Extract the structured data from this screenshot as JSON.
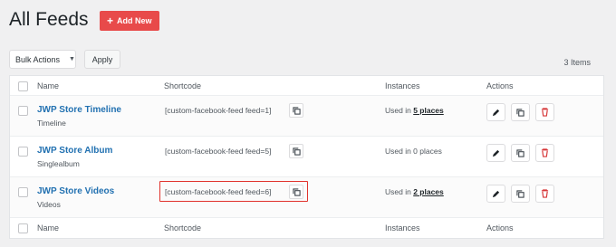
{
  "header": {
    "title": "All Feeds",
    "add_new_label": "Add New"
  },
  "toolbar": {
    "bulk_actions": "Bulk Actions",
    "apply_label": "Apply",
    "items_count": "3 Items"
  },
  "table": {
    "columns": {
      "name": "Name",
      "shortcode": "Shortcode",
      "instances": "Instances",
      "actions": "Actions"
    },
    "rows": [
      {
        "name": "JWP Store Timeline",
        "type": "Timeline",
        "shortcode": "[custom-facebook-feed feed=1]",
        "instances_prefix": "Used in",
        "instances_link": "5 places",
        "instances_text": ""
      },
      {
        "name": "JWP Store Album",
        "type": "Singlealbum",
        "shortcode": "[custom-facebook-feed feed=5]",
        "instances_prefix": "",
        "instances_link": "",
        "instances_text": "Used in 0 places"
      },
      {
        "name": "JWP Store Videos",
        "type": "Videos",
        "shortcode": "[custom-facebook-feed feed=6]",
        "instances_prefix": "Used in",
        "instances_link": "2 places",
        "instances_text": ""
      }
    ]
  },
  "colors": {
    "accent": "#e84a4a",
    "link": "#2271b1",
    "delete": "#d63638",
    "highlight": "#e0322c"
  },
  "icons": {
    "edit": "pencil-icon",
    "duplicate": "duplicate-icon",
    "delete": "trash-icon",
    "copy": "copy-icon"
  }
}
